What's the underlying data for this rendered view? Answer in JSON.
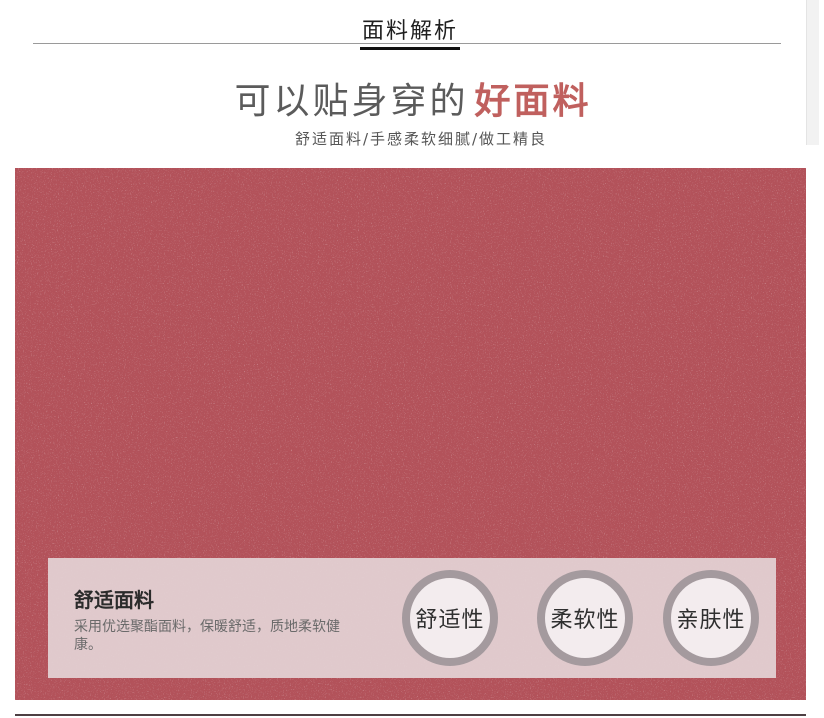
{
  "section": {
    "title": "面料解析"
  },
  "headline": {
    "lead": "可以贴身穿的",
    "accent": "好面料"
  },
  "subline": "舒适面料/手感柔软细腻/做工精良",
  "info": {
    "title": "舒适面料",
    "desc": "采用优选聚酯面料，保暖舒适，质地柔软健康。",
    "badges": [
      "舒适性",
      "柔软性",
      "亲肤性"
    ]
  },
  "colors": {
    "fabric": "#b3525a",
    "accent": "#c0605e",
    "badge_ring": "#a49a9e"
  }
}
